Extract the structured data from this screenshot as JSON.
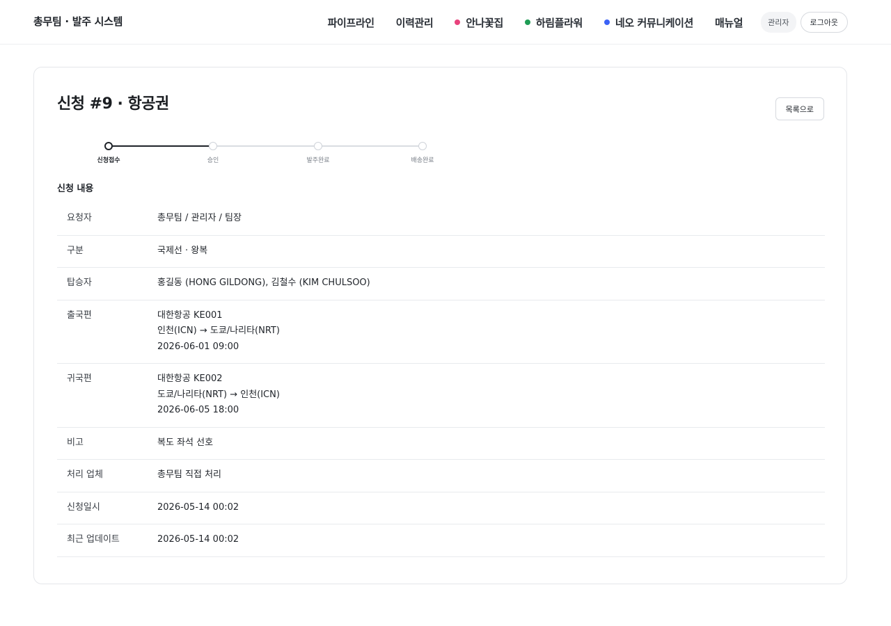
{
  "app": {
    "title": "총무팀 · 발주 시스템"
  },
  "nav": {
    "items": [
      {
        "label": "파이프라인"
      },
      {
        "label": "이력관리"
      },
      {
        "label": "안나꽃집",
        "dot_color": "#e8427c"
      },
      {
        "label": "하림플라워",
        "dot_color": "#1f9d55"
      },
      {
        "label": "네오 커뮤니케이션",
        "dot_color": "#3b62f6"
      },
      {
        "label": "매뉴얼"
      }
    ],
    "role": "관리자",
    "logout": "로그아웃"
  },
  "page": {
    "title": "신청 #9 · 항공권",
    "back_label": "목록으로"
  },
  "steps": {
    "current": 1,
    "items": [
      "신청접수",
      "승인",
      "발주완료",
      "배송완료"
    ]
  },
  "section": {
    "title": "신청 내용"
  },
  "details": {
    "requester": {
      "label": "요청자",
      "value": "총무팀 / 관리자 / 팀장"
    },
    "type": {
      "label": "구분",
      "value": "국제선 · 왕복"
    },
    "passengers": {
      "label": "탑승자",
      "value": "홍길동 (HONG GILDONG), 김철수 (KIM CHULSOO)"
    },
    "outbound": {
      "label": "출국편",
      "lines": [
        "대한항공 KE001",
        "인천(ICN) → 도쿄/나리타(NRT)",
        "2026-06-01 09:00"
      ]
    },
    "inbound": {
      "label": "귀국편",
      "lines": [
        "대한항공 KE002",
        "도쿄/나리타(NRT) → 인천(ICN)",
        "2026-06-05 18:00"
      ]
    },
    "note": {
      "label": "비고",
      "value": "복도 좌석 선호"
    },
    "vendor": {
      "label": "처리 업체",
      "value": "총무팀 직접 처리"
    },
    "requested_at": {
      "label": "신청일시",
      "value": "2026-05-14 00:02"
    },
    "updated_at": {
      "label": "최근 업데이트",
      "value": "2026-05-14 00:02"
    }
  }
}
